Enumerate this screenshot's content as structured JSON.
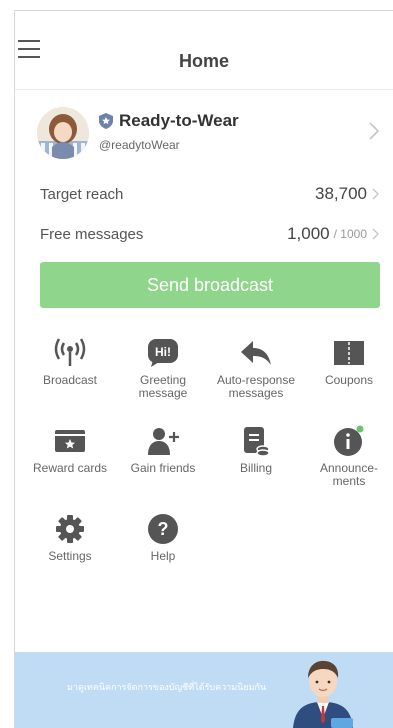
{
  "header": {
    "title": "Home"
  },
  "account": {
    "name": "Ready-to-Wear",
    "handle": "@readytoWear"
  },
  "stats": {
    "target_reach_label": "Target reach",
    "target_reach_value": "38,700",
    "free_messages_label": "Free messages",
    "free_messages_value": "1,000",
    "free_messages_total": "/ 1000"
  },
  "send_button": {
    "label": "Send broadcast"
  },
  "menu": [
    {
      "label": "Broadcast",
      "icon": "broadcast-icon"
    },
    {
      "label": "Greeting message",
      "icon": "greeting-icon"
    },
    {
      "label": "Auto-response messages",
      "icon": "reply-icon"
    },
    {
      "label": "Coupons",
      "icon": "coupon-icon"
    },
    {
      "label": "Reward cards",
      "icon": "reward-card-icon"
    },
    {
      "label": "Gain friends",
      "icon": "add-friend-icon"
    },
    {
      "label": "Billing",
      "icon": "billing-icon"
    },
    {
      "label": "Announce-ments",
      "icon": "info-icon"
    },
    {
      "label": "Settings",
      "icon": "gear-icon"
    },
    {
      "label": "Help",
      "icon": "help-icon"
    }
  ],
  "banner": {
    "text": "มาดูเทคนิคการจัดการของบัญชีที่ได้รับความนิยมกัน"
  },
  "colors": {
    "accent_green": "#8fd58b",
    "icon_gray": "#555555",
    "badge_green": "#6cc56a",
    "banner_blue": "#bfdcf4"
  }
}
